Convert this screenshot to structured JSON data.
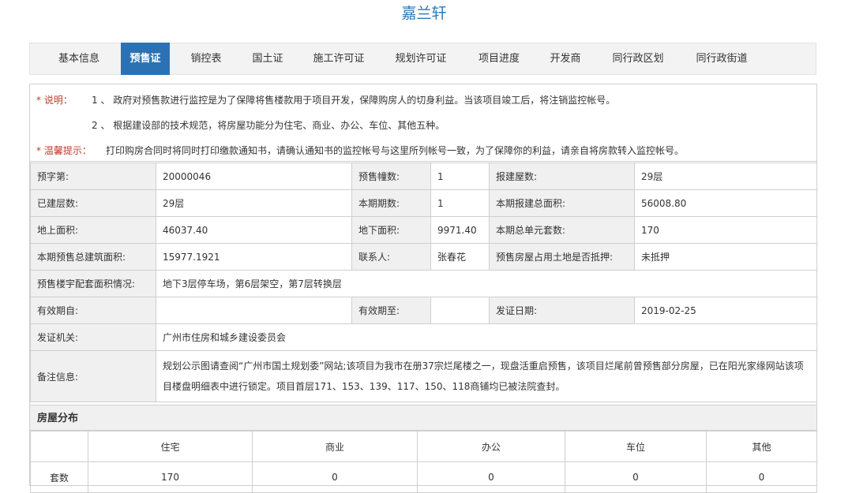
{
  "title": "嘉兰轩",
  "tabs": [
    "基本信息",
    "预售证",
    "销控表",
    "国土证",
    "施工许可证",
    "规划许可证",
    "项目进度",
    "开发商",
    "同行政区划",
    "同行政街道"
  ],
  "active_tab": "预售证",
  "notes": {
    "label1": "* 说明：",
    "line1": "1 、 政府对预售款进行监控是为了保障将售楼款用于项目开发，保障购房人的切身利益。当该项目竣工后，将注销监控帐号。",
    "line2": "2 、 根据建设部的技术规范，将房屋功能分为住宅、商业、办公、车位、其他五种。",
    "label2": "* 温馨提示：",
    "line3": "打印购房合同时将同时打印缴款通知书，请确认通知书的监控帐号与这里所列帐号一致，为了保障你的利益，请亲自将房款转入监控帐号。"
  },
  "info": {
    "presale_no_label": "预字第:",
    "presale_no": "20000046",
    "presale_buildings_label": "预售幢数:",
    "presale_buildings": "1",
    "reported_floors_label": "报建屋数:",
    "reported_floors": "29层",
    "built_floors_label": "已建层数:",
    "built_floors": "29层",
    "phase_count_label": "本期期数:",
    "phase_count": "1",
    "total_area_label": "本期报建总面积:",
    "total_area": "56008.80",
    "above_area_label": "地上面积:",
    "above_area": "46037.40",
    "below_area_label": "地下面积:",
    "below_area": "9971.40",
    "total_units_label": "本期总单元套数:",
    "total_units": "170",
    "presale_area_label": "本期预售总建筑面积:",
    "presale_area": "15977.1921",
    "contact_label": "联系人:",
    "contact": "张春花",
    "mortgage_label": "预售房屋占用土地是否抵押:",
    "mortgage": "未抵押",
    "facilities_label": "预售楼宇配套面积情况:",
    "facilities": "地下3层停车场，第6层架空，第7层转换层",
    "valid_from_label": "有效期自:",
    "valid_from": "",
    "valid_to_label": "有效期至:",
    "valid_to": "",
    "issue_date_label": "发证日期:",
    "issue_date": "2019-02-25",
    "issuer_label": "发证机关:",
    "issuer": "广州市住房和城乡建设委员会",
    "remark_label": "备注信息:",
    "remark": "规划公示图请查阅“广州市国土规划委”网站;该项目为我市在册37宗烂尾楼之一，现盘活重启预售，该项目烂尾前曾预售部分房屋，已在阳光家缘网站该项目楼盘明细表中进行锁定。项目首层171、153、139、117、150、118商铺均已被法院查封。"
  },
  "distribution": {
    "heading": "房屋分布",
    "columns": [
      "住宅",
      "商业",
      "办公",
      "车位",
      "其他"
    ],
    "row_label": "套数",
    "values": [
      "170",
      "0",
      "0",
      "0",
      "0"
    ]
  },
  "colors": {
    "title": "#2d78b8",
    "active_tab": "#2b72b5",
    "note_label": "#c0392b"
  }
}
